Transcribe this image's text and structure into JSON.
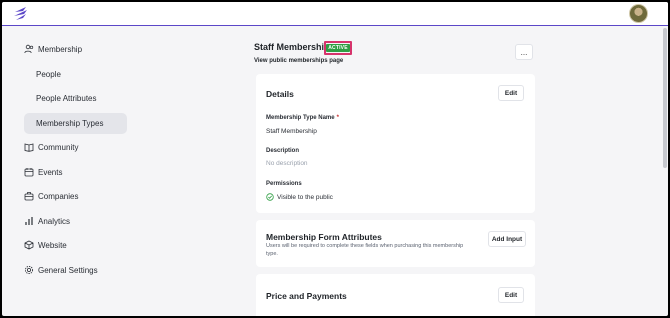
{
  "sidebar": {
    "items": [
      {
        "label": "Membership",
        "icon": "users-icon"
      },
      {
        "label": "Community",
        "icon": "book-icon"
      },
      {
        "label": "Events",
        "icon": "calendar-icon"
      },
      {
        "label": "Companies",
        "icon": "briefcase-icon"
      },
      {
        "label": "Analytics",
        "icon": "bar-chart-icon"
      },
      {
        "label": "Website",
        "icon": "cube-icon"
      },
      {
        "label": "General Settings",
        "icon": "gear-icon"
      }
    ],
    "sub_items": [
      {
        "label": "People"
      },
      {
        "label": "People Attributes"
      },
      {
        "label": "Membership Types",
        "active": true
      }
    ]
  },
  "header": {
    "title": "Staff Membership",
    "badge": "ACTIVE",
    "link": "View public memberships page",
    "more": "..."
  },
  "details": {
    "title": "Details",
    "edit": "Edit",
    "name_label": "Membership Type Name",
    "required_mark": "*",
    "name_value": "Staff Membership",
    "description_label": "Description",
    "description_value": "No description",
    "permissions_label": "Permissions",
    "permissions_value": "Visible to the public"
  },
  "form_attributes": {
    "title": "Membership Form Attributes",
    "description": "Users will be required to complete these fields when purchasing this membership type.",
    "button": "Add Input"
  },
  "price": {
    "title": "Price and Payments",
    "edit": "Edit"
  },
  "colors": {
    "accent": "#5b47c8",
    "badge_green": "#2f9e44",
    "highlight_border": "#d6336c"
  }
}
